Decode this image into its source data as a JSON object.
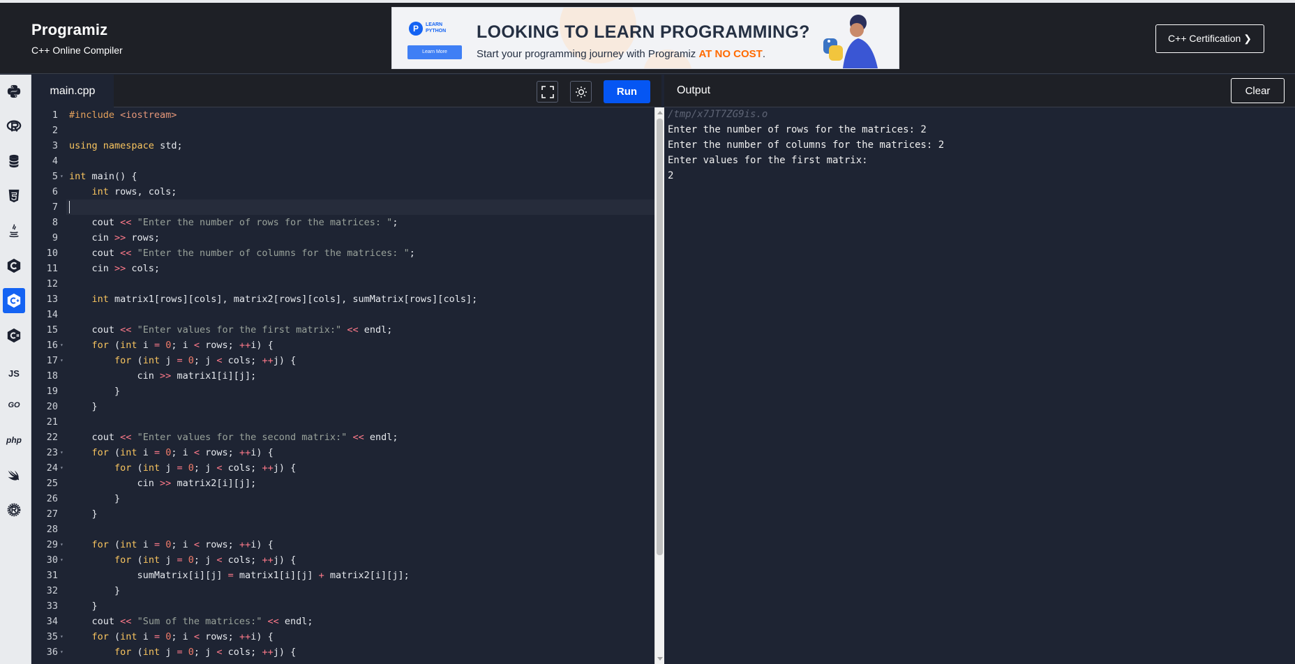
{
  "header": {
    "logo_text": "Programiz",
    "subtitle": "C++ Online Compiler",
    "cert_button": "C++ Certification ❯"
  },
  "ad": {
    "badge_line1": "LEARN",
    "badge_line2": "PYTHON",
    "badge_button": "Learn More",
    "headline": "LOOKING TO LEARN PROGRAMMING?",
    "tagline_prefix": "Start your programming journey with Programiz ",
    "tagline_highlight": "AT NO COST",
    "tagline_suffix": "."
  },
  "sidebar": {
    "languages": [
      {
        "name": "python",
        "icon": "python-icon",
        "active": false
      },
      {
        "name": "r",
        "icon": "r-icon",
        "active": false
      },
      {
        "name": "sql",
        "icon": "database-icon",
        "active": false
      },
      {
        "name": "html",
        "icon": "html5-icon",
        "active": false
      },
      {
        "name": "java",
        "icon": "java-icon",
        "active": false
      },
      {
        "name": "c",
        "icon": "c-icon",
        "active": false
      },
      {
        "name": "cpp",
        "icon": "cpp-icon",
        "active": true
      },
      {
        "name": "csharp",
        "icon": "csharp-icon",
        "active": false
      },
      {
        "name": "javascript",
        "icon": "js-icon",
        "label": "JS",
        "active": false
      },
      {
        "name": "go",
        "icon": "go-icon",
        "label": "GO",
        "active": false
      },
      {
        "name": "php",
        "icon": "php-icon",
        "label": "php",
        "active": false
      },
      {
        "name": "swift",
        "icon": "swift-icon",
        "active": false
      },
      {
        "name": "rust",
        "icon": "rust-icon",
        "active": false
      }
    ]
  },
  "editor": {
    "file_name": "main.cpp",
    "run_label": "Run",
    "active_line": 7,
    "fold_lines": [
      5,
      16,
      17,
      23,
      24,
      29,
      30,
      35,
      36
    ],
    "lines": [
      "#include <iostream>",
      "",
      "using namespace std;",
      "",
      "int main() {",
      "    int rows, cols;",
      "",
      "    cout << \"Enter the number of rows for the matrices: \";",
      "    cin >> rows;",
      "    cout << \"Enter the number of columns for the matrices: \";",
      "    cin >> cols;",
      "",
      "    int matrix1[rows][cols], matrix2[rows][cols], sumMatrix[rows][cols];",
      "",
      "    cout << \"Enter values for the first matrix:\" << endl;",
      "    for (int i = 0; i < rows; ++i) {",
      "        for (int j = 0; j < cols; ++j) {",
      "            cin >> matrix1[i][j];",
      "        }",
      "    }",
      "",
      "    cout << \"Enter values for the second matrix:\" << endl;",
      "    for (int i = 0; i < rows; ++i) {",
      "        for (int j = 0; j < cols; ++j) {",
      "            cin >> matrix2[i][j];",
      "        }",
      "    }",
      "",
      "    for (int i = 0; i < rows; ++i) {",
      "        for (int j = 0; j < cols; ++j) {",
      "            sumMatrix[i][j] = matrix1[i][j] + matrix2[i][j];",
      "        }",
      "    }",
      "    cout << \"Sum of the matrices:\" << endl;",
      "    for (int i = 0; i < rows; ++i) {",
      "        for (int j = 0; j < cols; ++j) {"
    ]
  },
  "output": {
    "title": "Output",
    "clear_label": "Clear",
    "path": "/tmp/x7JT7ZG9is.o",
    "lines": [
      "Enter the number of rows for the matrices: 2",
      "Enter the number of columns for the matrices: 2",
      "Enter values for the first matrix:",
      "2"
    ]
  }
}
